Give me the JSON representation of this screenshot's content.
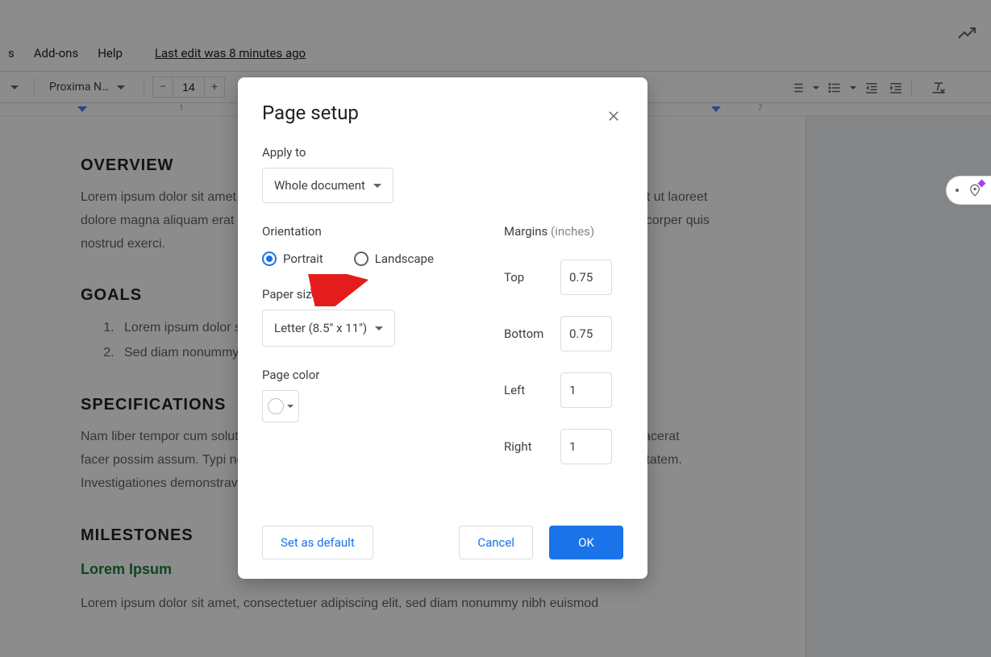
{
  "menu": {
    "items": [
      "s",
      "Add-ons",
      "Help"
    ],
    "lastedit": "Last edit was 8 minutes ago"
  },
  "toolbar": {
    "font_name": "Proxima N…",
    "font_size": "14",
    "ruler_numbers": [
      "1",
      "7"
    ]
  },
  "doc": {
    "h_overview": "OVERVIEW",
    "p_overview": "Lorem ipsum dolor sit amet, consectetuer adipiscing elit, sed diam nonummy nibh euismod tincidunt ut laoreet dolore magna aliquam erat volutpat. Ut wisi enim ad minim veniam, quis nostrud exerci tation ullamcorper quis nostrud exerci.",
    "h_goals": "GOALS",
    "goal1": "Lorem ipsum dolor sit amet, consectetuer adipiscing elit.",
    "goal2": "Sed diam nonummy nibh euismod tincidunt ut laoreet dolore magna aliquam erat volutpat.",
    "h_specs": "SPECIFICATIONS",
    "p_specs": "Nam liber tempor cum soluta nobis eleifend option congue nihil imperdiet doming id quod mazim placerat facer possim assum. Typi non habent claritatem insitam; est usus legentis in iis qui facit eorum claritatem. Investigationes demonstraverunt lectores legere me lius quod ii legunt saepius.",
    "h_milestones": "MILESTONES",
    "link_lorem": "Lorem Ipsum",
    "p_last": "Lorem ipsum dolor sit amet, consectetuer adipiscing elit, sed diam nonummy nibh euismod"
  },
  "dialog": {
    "title": "Page setup",
    "apply_to_label": "Apply to",
    "apply_to_value": "Whole document",
    "orientation_label": "Orientation",
    "orientation_portrait": "Portrait",
    "orientation_landscape": "Landscape",
    "paper_size_label": "Paper size",
    "paper_size_value": "Letter (8.5\" x 11\")",
    "page_color_label": "Page color",
    "margins_label": "Margins",
    "margins_unit": "(inches)",
    "margin_top_label": "Top",
    "margin_top_value": "0.75",
    "margin_bottom_label": "Bottom",
    "margin_bottom_value": "0.75",
    "margin_left_label": "Left",
    "margin_left_value": "1",
    "margin_right_label": "Right",
    "margin_right_value": "1",
    "set_default": "Set as default",
    "cancel": "Cancel",
    "ok": "OK"
  }
}
